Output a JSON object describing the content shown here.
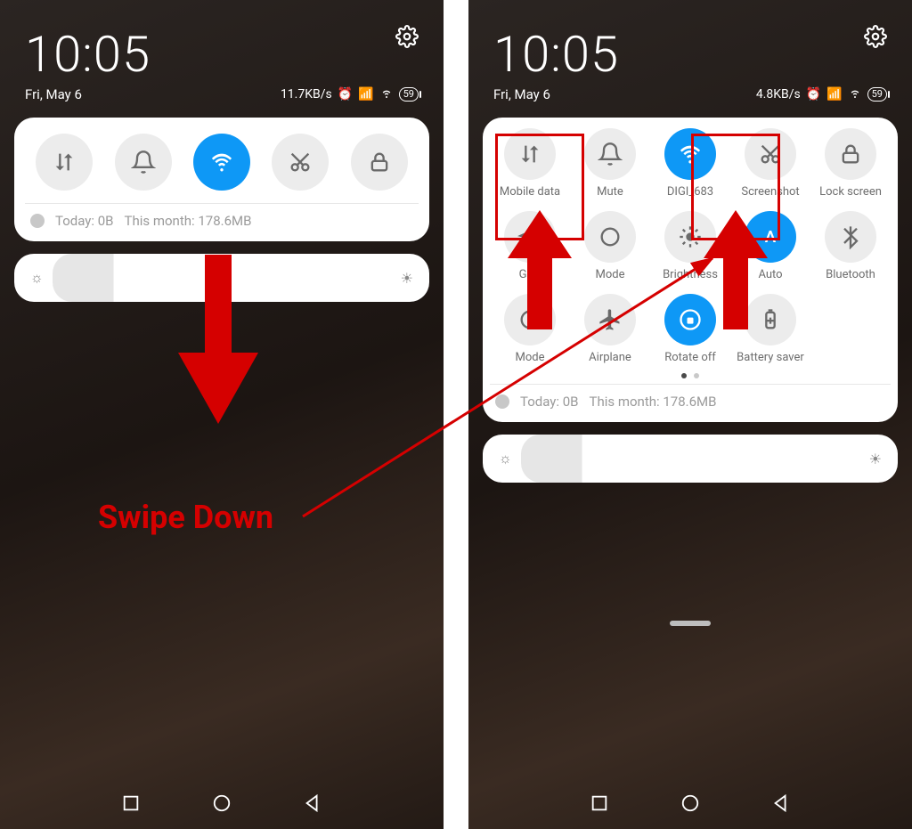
{
  "left": {
    "time": "10:05",
    "date": "Fri, May 6",
    "net_speed": "11.7KB/s",
    "battery": "59",
    "usage_today_label": "Today: 0B",
    "usage_month_label": "This month: 178.6MB"
  },
  "right": {
    "time": "10:05",
    "date": "Fri, May 6",
    "net_speed": "4.8KB/s",
    "battery": "59",
    "tiles": [
      {
        "label": "Mobile data",
        "icon": "data",
        "on": false
      },
      {
        "label": "Mute",
        "icon": "bell",
        "on": false
      },
      {
        "label": "DIGI_683",
        "icon": "wifi",
        "on": true
      },
      {
        "label": "Screenshot",
        "icon": "scissors",
        "on": false
      },
      {
        "label": "Lock screen",
        "icon": "lock",
        "on": false
      },
      {
        "label": "GPS",
        "icon": "gps",
        "on": false
      },
      {
        "label": "Mode",
        "icon": "mode",
        "on": false
      },
      {
        "label": "Brightness",
        "icon": "bright",
        "on": false
      },
      {
        "label": "Auto",
        "icon": "A",
        "on": true
      },
      {
        "label": "Bluetooth",
        "icon": "bt",
        "on": false
      },
      {
        "label": "Mode",
        "icon": "mode",
        "on": false
      },
      {
        "label": "Airplane",
        "icon": "plane",
        "on": false
      },
      {
        "label": "Rotate off",
        "icon": "rotate",
        "on": true
      },
      {
        "label": "Battery saver",
        "icon": "battsave",
        "on": false
      }
    ],
    "usage_today_label": "Today: 0B",
    "usage_month_label": "This month: 178.6MB"
  },
  "annotation": {
    "caption": "Swipe Down"
  }
}
